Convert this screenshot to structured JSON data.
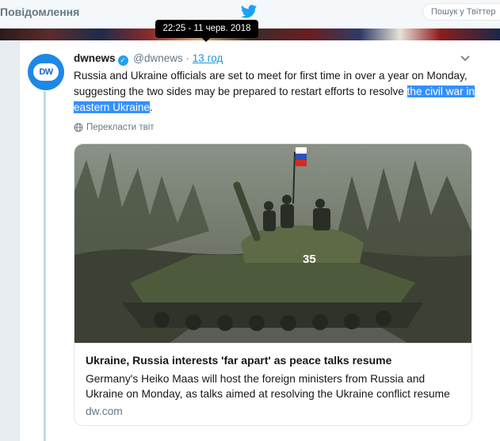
{
  "nav": {
    "label": "Повідомлення",
    "search_placeholder": "Пошук у Твіттер"
  },
  "tooltip": {
    "text": "22:25 - 11 черв. 2018"
  },
  "tweet": {
    "avatar_text": "DW",
    "name": "dwnews",
    "handle": "@dwnews",
    "separator": "·",
    "time": "13 год",
    "text_plain": "Russia and Ukraine officials are set to meet for first time in over a year on Monday, suggesting the two sides may be prepared to restart efforts to resolve ",
    "text_highlight": "the civil war in eastern Ukraine",
    "text_end": ".",
    "translate_label": "Перекласти твіт"
  },
  "card": {
    "photo_label": "35",
    "title": "Ukraine, Russia interests 'far apart' as peace talks resume",
    "description": "Germany's Heiko Maas will host the foreign ministers from Russia and Ukraine on Monday, as talks aimed at resolving the Ukraine conflict resume",
    "domain": "dw.com"
  },
  "colors": {
    "link": "#1b95e0",
    "accent": "#1da1f2",
    "highlight": "#3390ff"
  },
  "icons": [
    "twitter-bird-icon",
    "verified-badge-icon",
    "chevron-down-icon",
    "globe-icon"
  ]
}
